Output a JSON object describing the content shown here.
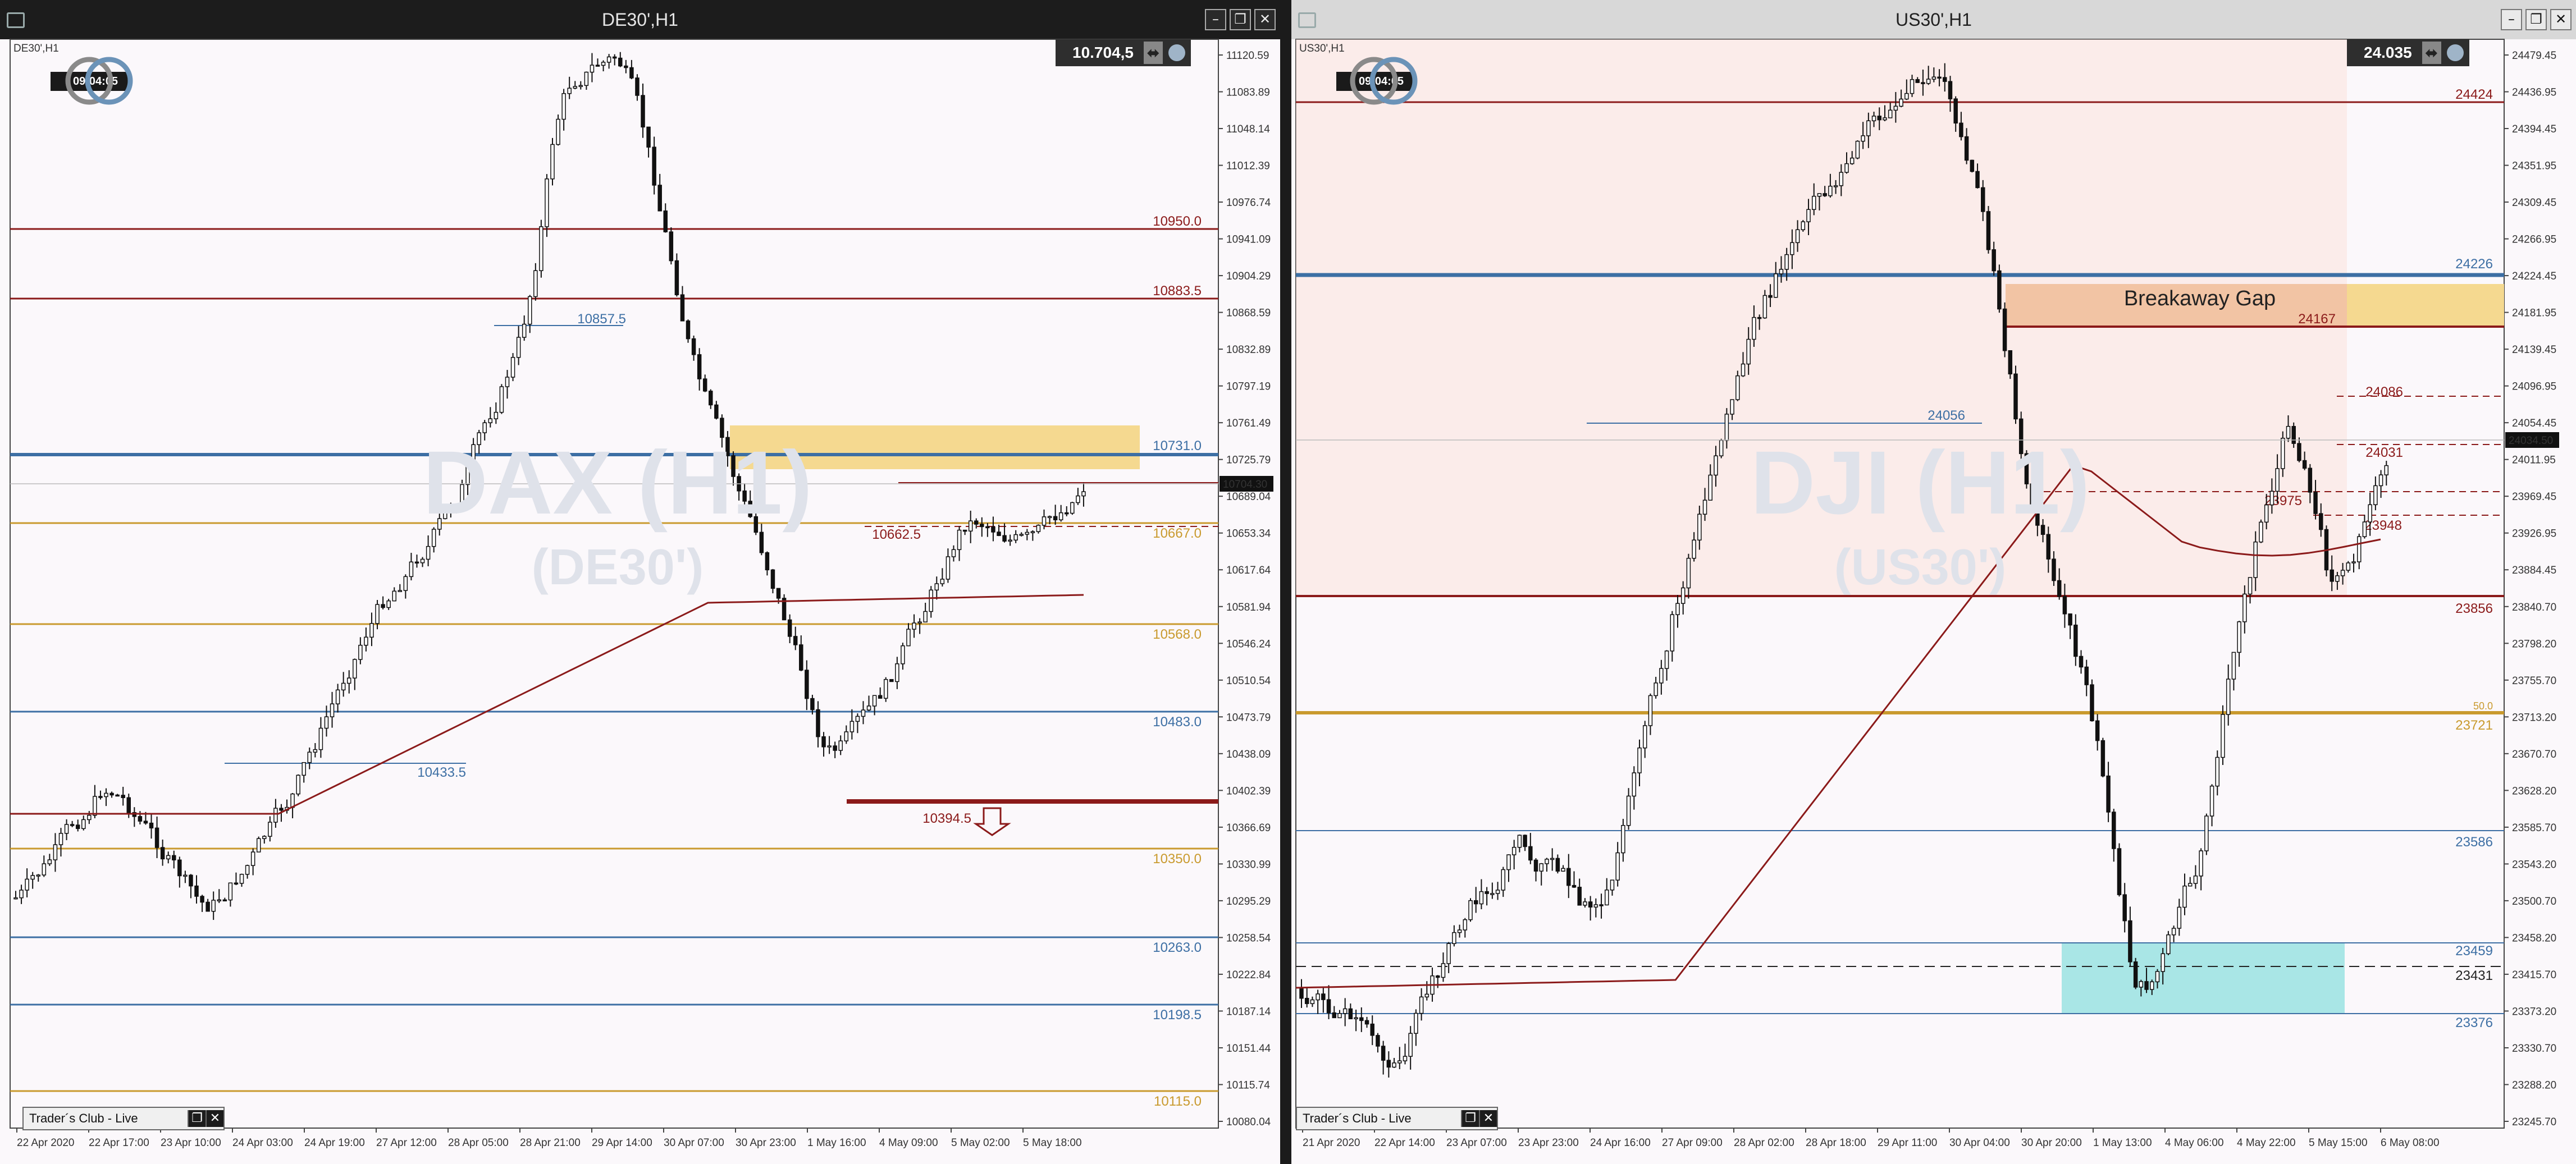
{
  "left": {
    "title": "DE30',H1",
    "corner": "DE30',H1",
    "ticker": "10.704,5",
    "clock": "09:04:05",
    "watermark": "DAX (H1)",
    "watermark_sub": "(DE30')",
    "taskbar": "Trader´s Club - Live",
    "current_price": "10704.30",
    "price_axis": [
      "11120.59",
      "11083.89",
      "11048.14",
      "11012.39",
      "10976.74",
      "10941.09",
      "10904.29",
      "10868.59",
      "10832.89",
      "10797.19",
      "10761.49",
      "10725.79",
      "10689.04",
      "10653.34",
      "10617.64",
      "10581.94",
      "10546.24",
      "10510.54",
      "10473.79",
      "10438.09",
      "10402.39",
      "10366.69",
      "10330.99",
      "10295.29",
      "10258.54",
      "10222.84",
      "10187.14",
      "10151.44",
      "10115.74",
      "10080.04"
    ],
    "time_axis": [
      "22 Apr 2020",
      "22 Apr 17:00",
      "23 Apr 10:00",
      "24 Apr 03:00",
      "24 Apr 19:00",
      "27 Apr 12:00",
      "28 Apr 05:00",
      "28 Apr 21:00",
      "29 Apr 14:00",
      "30 Apr 07:00",
      "30 Apr 23:00",
      "1 May 16:00",
      "4 May 09:00",
      "5 May 02:00",
      "5 May 18:00"
    ],
    "levels": {
      "l10950": "10950.0",
      "l10883": "10883.5",
      "l10857": "10857.5",
      "l10731": "10731.0",
      "l10667": "10667.0",
      "l10662": "10662.5",
      "l10568": "10568.0",
      "l10483": "10483.0",
      "l10433": "10433.5",
      "l10394": "10394.5",
      "l10350": "10350.0",
      "l10263": "10263.0",
      "l10198": "10198.5",
      "l10115": "10115.0"
    }
  },
  "right": {
    "title": "US30',H1",
    "corner": "US30',H1",
    "ticker": "24.035",
    "clock": "09:04:05",
    "watermark": "DJI (H1)",
    "watermark_sub": "(US30')",
    "taskbar": "Trader´s Club - Live",
    "current_price": "24034.50",
    "gap_label": "Breakaway Gap",
    "price_axis": [
      "24479.45",
      "24436.95",
      "24394.45",
      "24351.95",
      "24309.45",
      "24266.95",
      "24224.45",
      "24181.95",
      "24139.45",
      "24096.95",
      "24054.45",
      "24011.95",
      "23969.45",
      "23926.95",
      "23884.45",
      "23840.70",
      "23798.20",
      "23755.70",
      "23713.20",
      "23670.70",
      "23628.20",
      "23585.70",
      "23543.20",
      "23500.70",
      "23458.20",
      "23415.70",
      "23373.20",
      "23330.70",
      "23288.20",
      "23245.70"
    ],
    "time_axis": [
      "21 Apr 2020",
      "22 Apr 14:00",
      "23 Apr 07:00",
      "23 Apr 23:00",
      "24 Apr 16:00",
      "27 Apr 09:00",
      "28 Apr 02:00",
      "28 Apr 18:00",
      "29 Apr 11:00",
      "30 Apr 04:00",
      "30 Apr 20:00",
      "1 May 13:00",
      "4 May 06:00",
      "4 May 22:00",
      "5 May 15:00",
      "6 May 08:00"
    ],
    "levels": {
      "l24424": "24424",
      "l24226": "24226",
      "l24167": "24167",
      "l24086": "24086",
      "l24056": "24056",
      "l24031": "24031",
      "l23975": "23975",
      "l23948": "23948",
      "l23856": "23856",
      "l50": "50.0",
      "l23721": "23721",
      "l23586": "23586",
      "l23459": "23459",
      "l23431": "23431",
      "l23376": "23376"
    }
  },
  "colors": {
    "maroon": "#8b1a1a",
    "blue": "#3d6fa4",
    "gold": "#c99a2e",
    "gap_fill": "#f5d990",
    "zone_red": "#fbe2dc",
    "zone_cyan": "#a9e6e6",
    "ma": "#8b1a1a"
  },
  "icons": [
    "window-icon",
    "minimize-icon",
    "restore-icon",
    "close-icon",
    "arrow-down-icon",
    "logo-icon"
  ]
}
